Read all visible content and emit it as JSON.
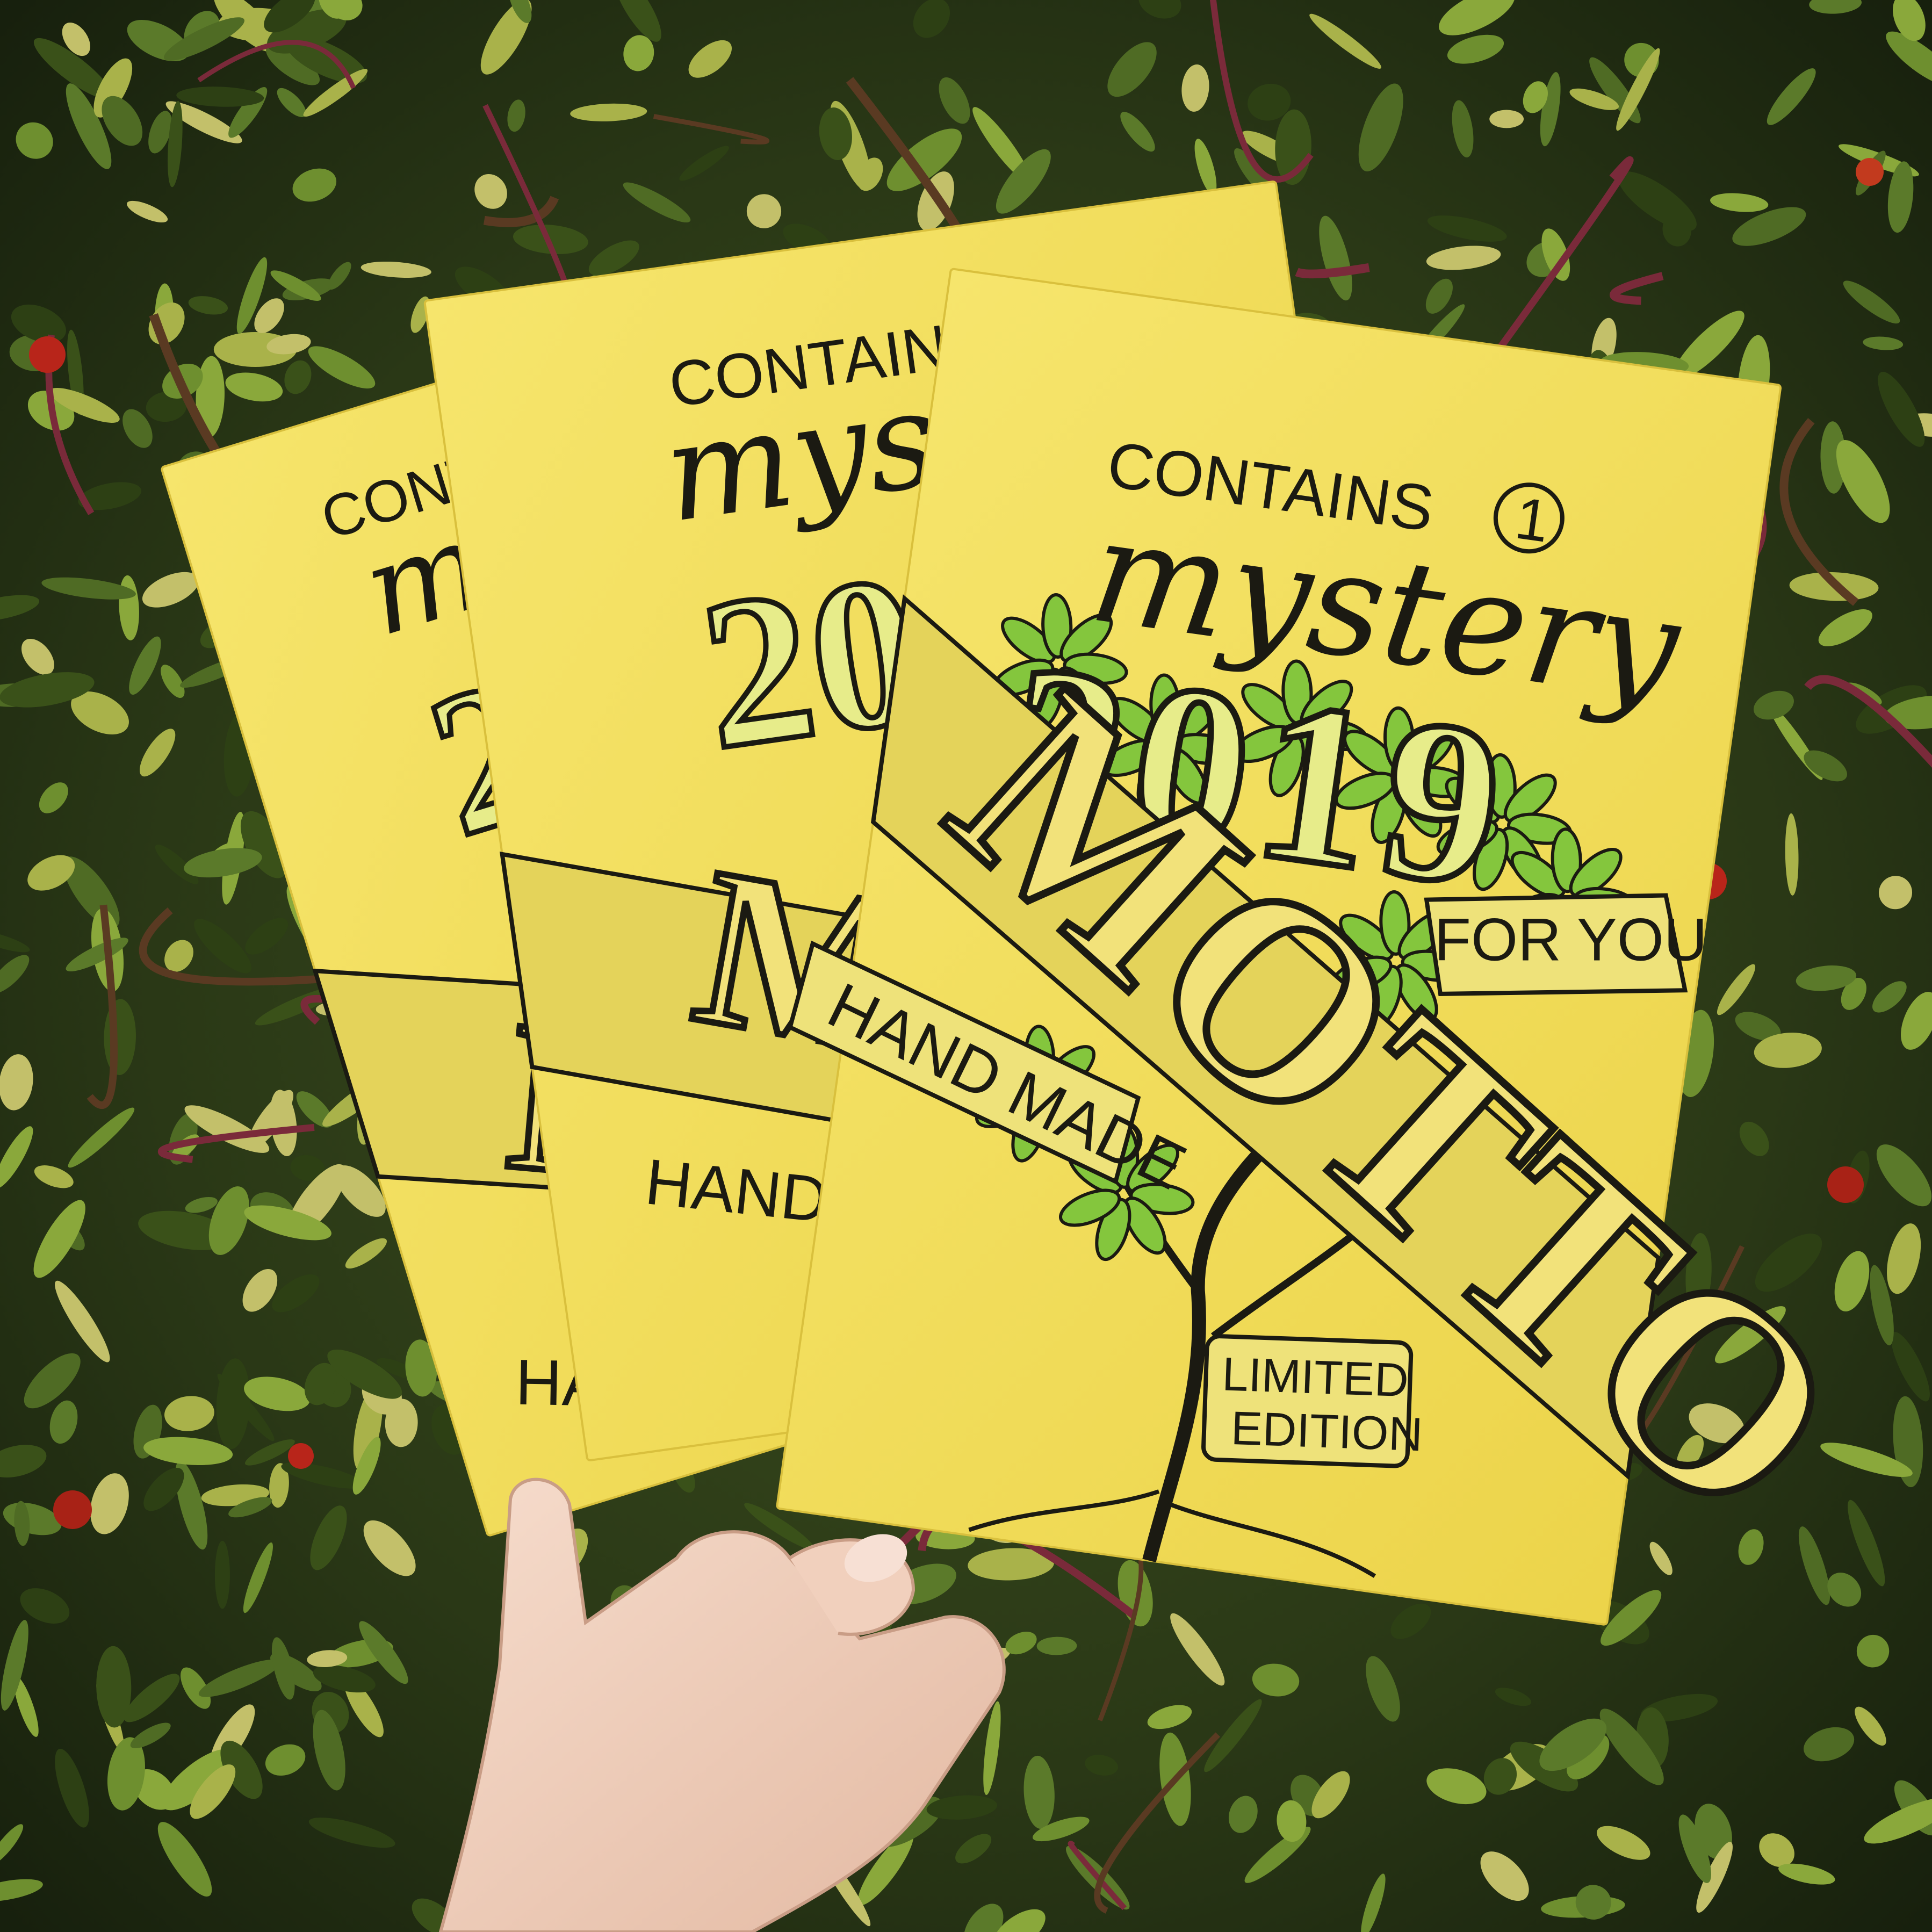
{
  "photo": {
    "description_colors": {
      "envelope": "#f3df5e",
      "envelope_shade": "#e8cf45",
      "leaf_green": "#7cc13a",
      "ink": "#1b1a12",
      "foliage_dark": "#26331a",
      "berry_red": "#b8251a"
    }
  },
  "envelopes": [
    {
      "contains": "CONTAINS",
      "count": "1",
      "mystery": "mystery",
      "year": "2019",
      "motto": "MOTTO",
      "banner_left": "HAND MADE",
      "banner_right": "FOR YOU",
      "badge_line1": "LIMITED",
      "badge_line2": "EDITION"
    }
  ]
}
